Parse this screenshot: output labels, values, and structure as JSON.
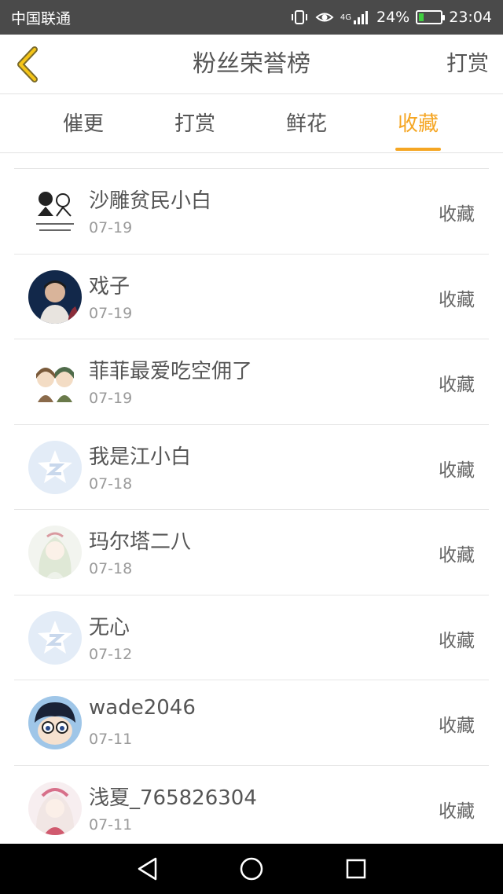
{
  "status_bar": {
    "carrier": "中国联通",
    "signal": "4G",
    "battery": "24%",
    "battery_level": 0.24,
    "time": "23:04"
  },
  "header": {
    "back_icon": "chevron-left-icon",
    "title": "粉丝荣誉榜",
    "action": "打赏"
  },
  "tabs": [
    {
      "label": "催更",
      "active": false
    },
    {
      "label": "打赏",
      "active": false
    },
    {
      "label": "鲜花",
      "active": false
    },
    {
      "label": "收藏",
      "active": true
    }
  ],
  "colors": {
    "accent": "#f5a623",
    "status_bar": "#4a4a4a",
    "nav_bar": "#000000"
  },
  "fans": [
    {
      "name": "沙雕贫民小白",
      "date": "07-19",
      "action": "收藏",
      "avatar": "sketch-couple-avatar"
    },
    {
      "name": "戏子",
      "date": "07-19",
      "action": "收藏",
      "avatar": "photo-avatar"
    },
    {
      "name": "菲菲最爱吃空佣了",
      "date": "07-19",
      "action": "收藏",
      "avatar": "anime-girls-avatar"
    },
    {
      "name": "我是江小白",
      "date": "07-18",
      "action": "收藏",
      "avatar": "default-star-avatar"
    },
    {
      "name": "玛尔塔二八",
      "date": "07-18",
      "action": "收藏",
      "avatar": "anime-girl-avatar"
    },
    {
      "name": "无心",
      "date": "07-12",
      "action": "收藏",
      "avatar": "default-star-avatar"
    },
    {
      "name": "wade2046",
      "date": "07-11",
      "action": "收藏",
      "avatar": "anime-boy-avatar"
    },
    {
      "name": "浅夏_765826304",
      "date": "07-11",
      "action": "收藏",
      "avatar": "anime-pink-avatar"
    }
  ],
  "nav_bar": {
    "back": "back-triangle-icon",
    "home": "home-circle-icon",
    "recent": "recent-square-icon"
  }
}
